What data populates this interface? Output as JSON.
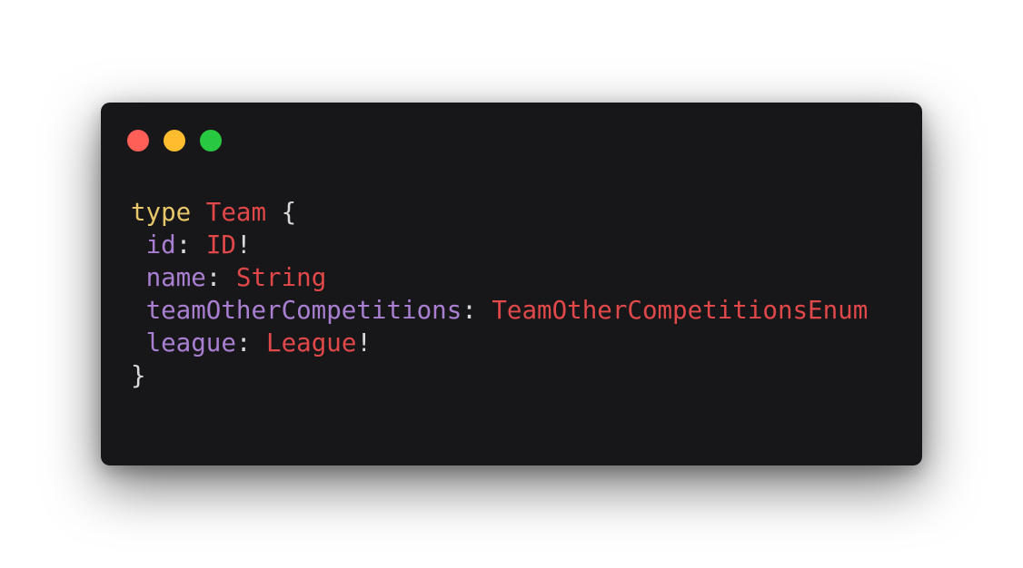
{
  "window": {
    "controls": {
      "close_color": "#ff5f57",
      "minimize_color": "#febc2e",
      "maximize_color": "#28c840"
    }
  },
  "colors": {
    "background": "#171719",
    "keyword": "#e8c76a",
    "type": "#e0484a",
    "field": "#a97fd1",
    "punctuation": "#d9d9d9"
  },
  "code": {
    "keyword": "type",
    "type_name": "Team",
    "open_brace": "{",
    "close_brace": "}",
    "fields": [
      {
        "name": "id",
        "colon": ":",
        "type": "ID",
        "bang": "!"
      },
      {
        "name": "name",
        "colon": ":",
        "type": "String",
        "bang": ""
      },
      {
        "name": "teamOtherCompetitions",
        "colon": ":",
        "type": "TeamOtherCompetitionsEnum",
        "bang": ""
      },
      {
        "name": "league",
        "colon": ":",
        "type": "League",
        "bang": "!"
      }
    ]
  }
}
